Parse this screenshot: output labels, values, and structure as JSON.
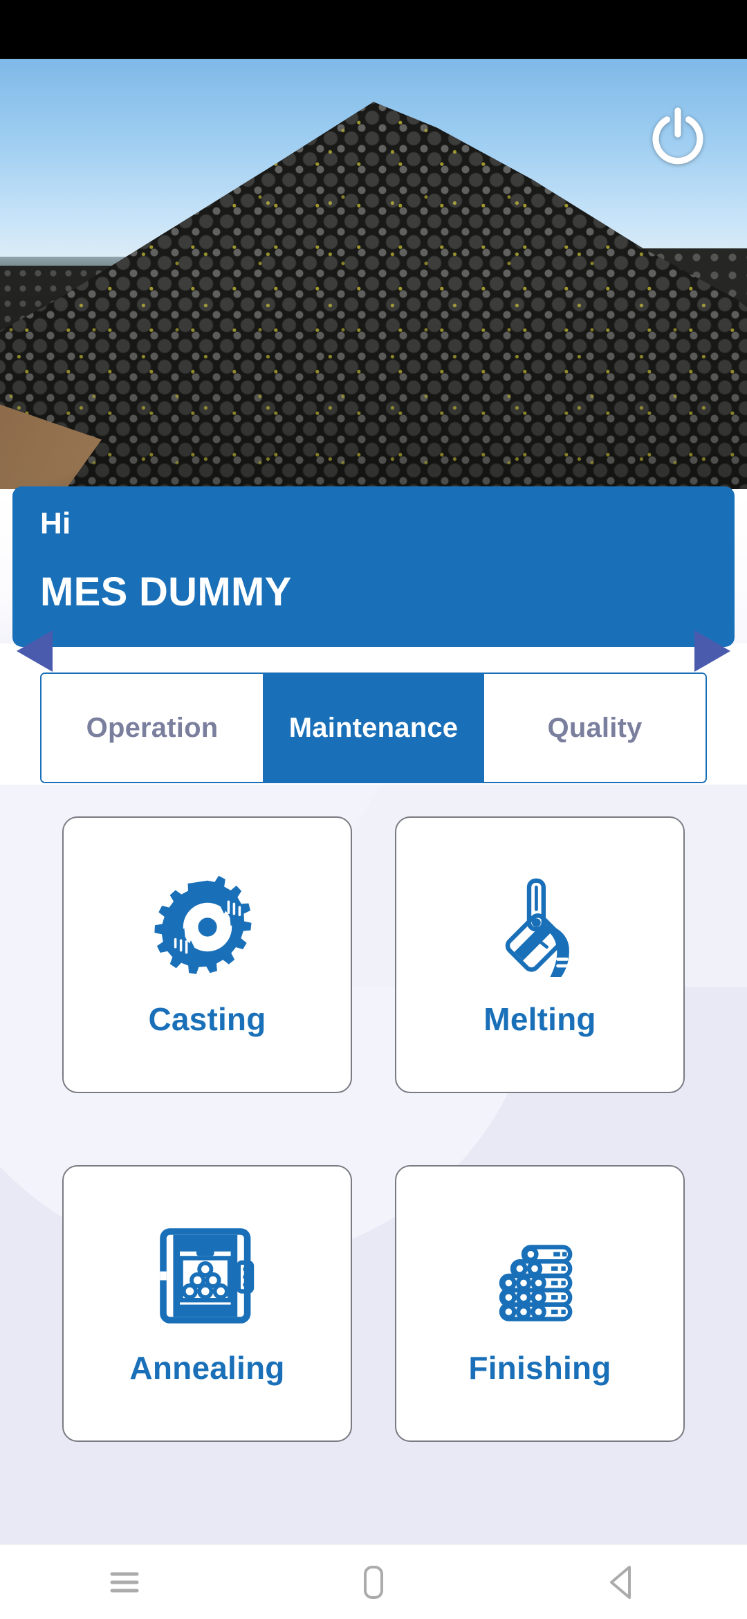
{
  "app": {
    "accent_blue": "#1A70B8",
    "tab_inactive_text": "#7B7F9E",
    "background_lavender": "#E9E9F6",
    "arrow_purple": "#4A5BAE"
  },
  "status_bar": {
    "name": "status-bar"
  },
  "hero": {
    "alt": "stacked ductile iron pipes yard",
    "power_icon": "power-icon"
  },
  "greeting": {
    "salutation": "Hi",
    "user_name": "MES DUMMY"
  },
  "carousel": {
    "prev_icon": "chevron-left-icon",
    "next_icon": "chevron-right-icon"
  },
  "tabs": {
    "selected": "Maintenance",
    "items": [
      {
        "label": "Operation",
        "active": false
      },
      {
        "label": "Maintenance",
        "active": true
      },
      {
        "label": "Quality",
        "active": false
      }
    ]
  },
  "modules": [
    {
      "label": "Casting",
      "icon": "gear-hands-icon"
    },
    {
      "label": "Melting",
      "icon": "ladle-pour-icon"
    },
    {
      "label": "Annealing",
      "icon": "furnace-icon"
    },
    {
      "label": "Finishing",
      "icon": "pipe-stack-icon"
    }
  ],
  "android_nav": {
    "recents_label": "recents-icon",
    "home_label": "home-icon",
    "back_label": "back-icon"
  }
}
